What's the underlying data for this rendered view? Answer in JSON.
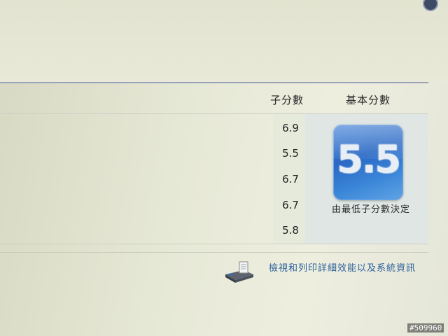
{
  "table": {
    "headers": {
      "subscore": "子分數",
      "base_score": "基本分數"
    },
    "subscores": [
      "6.9",
      "5.5",
      "6.7",
      "6.7",
      "5.8"
    ]
  },
  "base_score": {
    "value": "5.5",
    "caption": "由最低子分數決定"
  },
  "link": {
    "label": "檢視和列印詳細效能以及系統資訊"
  },
  "watermark": "#509960",
  "colors": {
    "badge_blue": "#2a68c4",
    "link_blue": "#2a5f9c",
    "divider": "#9aa2b8"
  },
  "icons": {
    "link_icon": "printer-computer-icon"
  }
}
